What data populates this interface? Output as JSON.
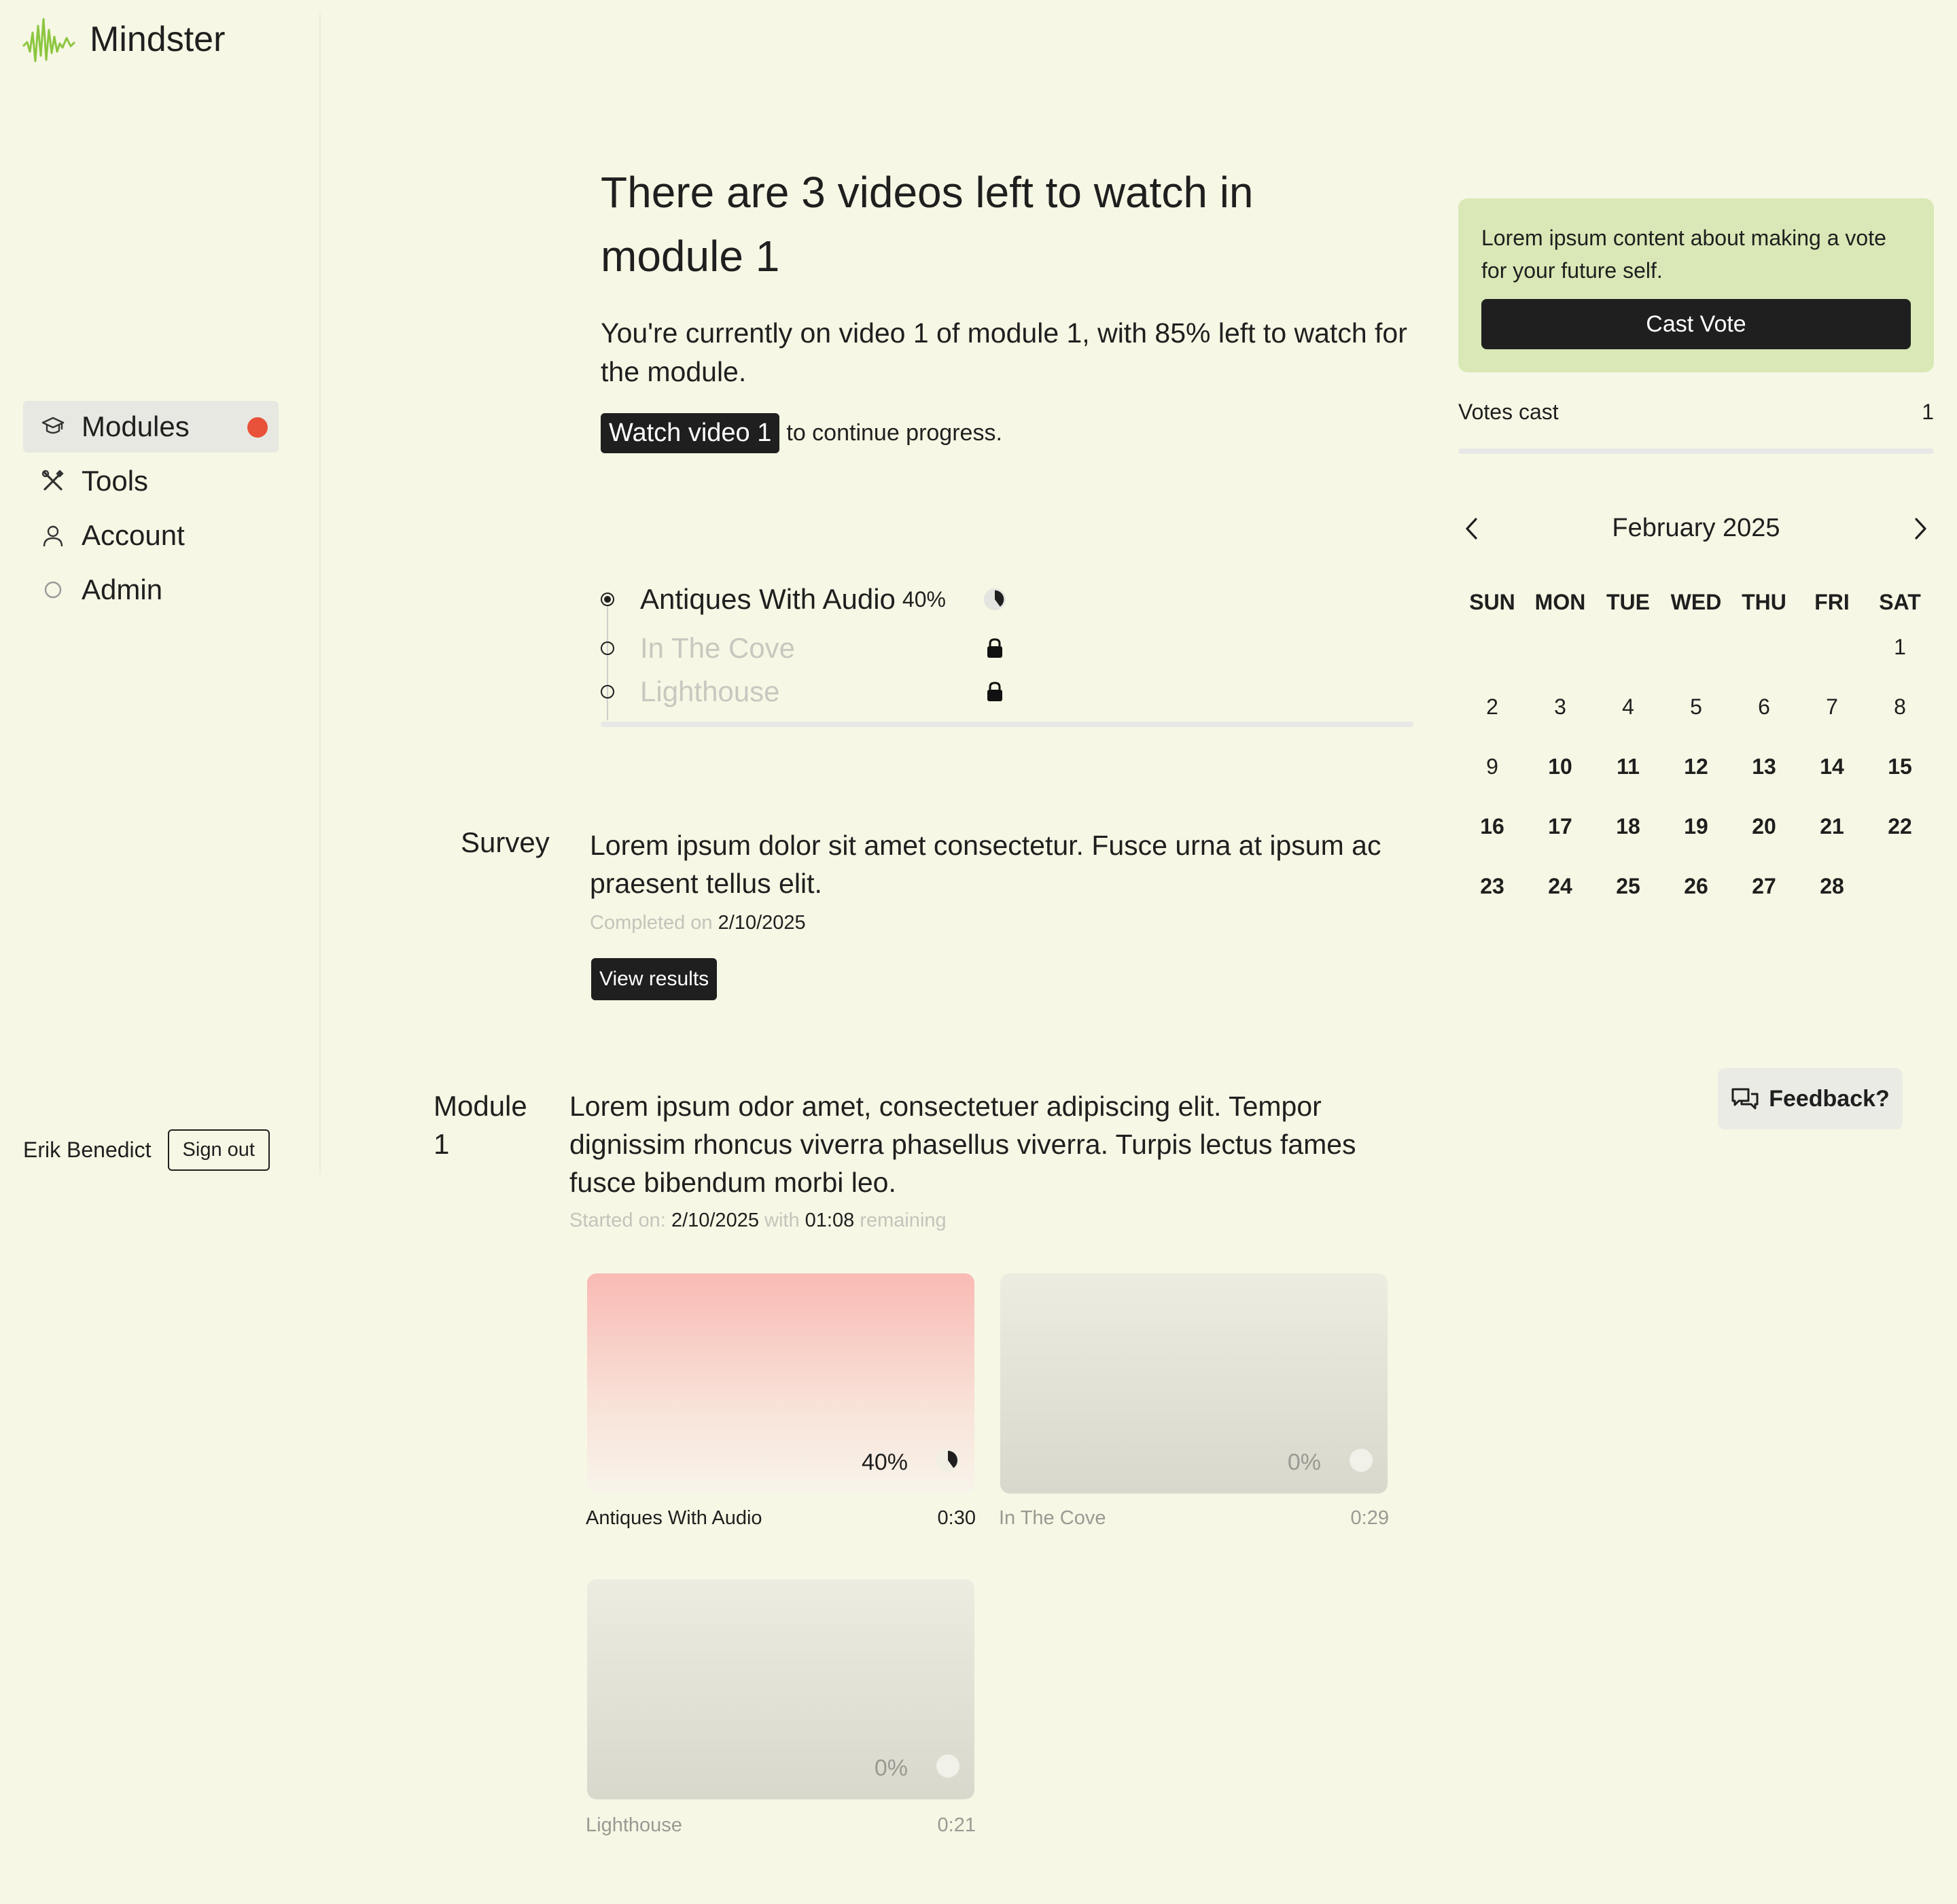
{
  "app": {
    "name": "Mindster"
  },
  "sidebar": {
    "items": [
      {
        "label": "Modules",
        "icon": "graduation-cap-icon",
        "active": true,
        "notification": true
      },
      {
        "label": "Tools",
        "icon": "tools-icon",
        "active": false
      },
      {
        "label": "Account",
        "icon": "user-icon",
        "active": false
      },
      {
        "label": "Admin",
        "icon": "circle-icon",
        "active": false
      }
    ],
    "user_name": "Erik Benedict",
    "sign_out_label": "Sign out"
  },
  "hero": {
    "title": "There are 3 videos left to watch in module 1",
    "subtitle": "You're currently on video 1 of module 1, with 85% left to watch for the module.",
    "cta_button": "Watch video 1",
    "cta_suffix": "to continue progress."
  },
  "video_list": [
    {
      "name": "Antiques With Audio",
      "percent": "40%",
      "progress": 0.4,
      "state": "current"
    },
    {
      "name": "In The Cove",
      "percent": "",
      "state": "locked"
    },
    {
      "name": "Lighthouse",
      "percent": "",
      "state": "locked"
    }
  ],
  "survey": {
    "label": "Survey",
    "text": "Lorem ipsum dolor sit amet consectetur. Fusce urna at ipsum ac praesent tellus elit.",
    "completed_prefix": "Completed on",
    "completed_date": "2/10/2025",
    "button": "View results"
  },
  "module": {
    "label": "Module 1",
    "text": "Lorem ipsum odor amet, consectetuer adipiscing elit. Tempor dignissim rhoncus viverra phasellus viverra. Turpis lectus fames fusce bibendum morbi leo.",
    "started_prefix": "Started on:",
    "started_date": "2/10/2025",
    "with_word": "with",
    "remaining_time": "01:08",
    "remaining_word": "remaining",
    "cards": [
      {
        "title": "Antiques With Audio",
        "duration": "0:30",
        "percent": "40%",
        "progress": 0.4
      },
      {
        "title": "In The Cove",
        "duration": "0:29",
        "percent": "0%",
        "progress": 0
      },
      {
        "title": "Lighthouse",
        "duration": "0:21",
        "percent": "0%",
        "progress": 0
      }
    ]
  },
  "vote": {
    "text": "Lorem ipsum content about making a vote for your future self.",
    "button": "Cast Vote",
    "votes_label": "Votes cast",
    "votes_count": "1"
  },
  "calendar": {
    "title": "February 2025",
    "days_of_week": [
      "SUN",
      "MON",
      "TUE",
      "WED",
      "THU",
      "FRI",
      "SAT"
    ],
    "weeks": [
      [
        "",
        "",
        "",
        "",
        "",
        "",
        "1"
      ],
      [
        "2",
        "3",
        "4",
        "5",
        "6",
        "7",
        "8"
      ],
      [
        "9",
        "10",
        "11",
        "12",
        "13",
        "14",
        "15"
      ],
      [
        "16",
        "17",
        "18",
        "19",
        "20",
        "21",
        "22"
      ],
      [
        "23",
        "24",
        "25",
        "26",
        "27",
        "28",
        ""
      ]
    ],
    "bold_from": 10
  },
  "feedback": {
    "label": "Feedback?"
  },
  "colors": {
    "background": "#f6f7e4",
    "accent_dark": "#1f1f1f",
    "notification": "#e8523a",
    "vote_box": "#d9e8b6",
    "card_pink": "#f9bab4"
  }
}
